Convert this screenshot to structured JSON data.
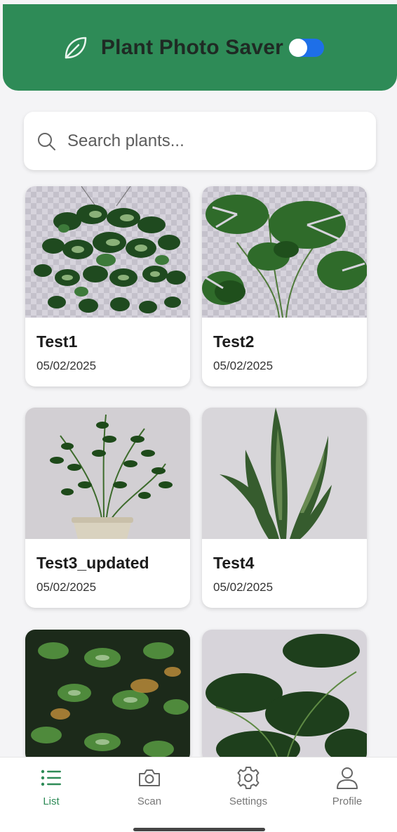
{
  "header": {
    "title": "Plant Photo Saver",
    "toggle_on": true
  },
  "search": {
    "placeholder": "Search plants...",
    "value": ""
  },
  "plants": [
    {
      "name": "Test1",
      "date": "05/02/2025"
    },
    {
      "name": "Test2",
      "date": "05/02/2025"
    },
    {
      "name": "Test3_updated",
      "date": "05/02/2025"
    },
    {
      "name": "Test4",
      "date": "05/02/2025"
    }
  ],
  "bottom_nav": [
    {
      "label": "List",
      "icon": "list-icon",
      "active": true
    },
    {
      "label": "Scan",
      "icon": "camera-icon",
      "active": false
    },
    {
      "label": "Settings",
      "icon": "gear-icon",
      "active": false
    },
    {
      "label": "Profile",
      "icon": "person-icon",
      "active": false
    }
  ],
  "colors": {
    "primary": "#2e8b57",
    "toggle": "#1e6fe8",
    "background": "#f4f4f6"
  }
}
